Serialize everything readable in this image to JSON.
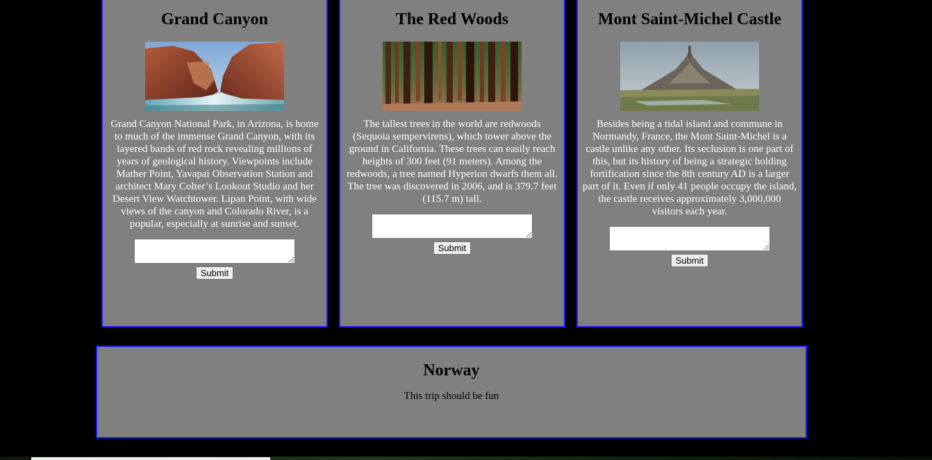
{
  "cards": [
    {
      "title": "Grand Canyon",
      "description": "Grand Canyon National Park, in Arizona, is home to much of the immense Grand Canyon, with its layered bands of red rock revealing millions of years of geological history. Viewpoints include Mather Point, Yavapai Observation Station and architect Mary Colter’s Lookout Studio and her Desert View Watchtower. Lipan Point, with wide views of the canyon and Colorado River, is a popular, especially at sunrise and sunset.",
      "input_value": "",
      "submit_label": "Submit"
    },
    {
      "title": "The Red Woods",
      "description": "The tallest trees in the world are redwoods (Sequoia sempervirens), which tower above the ground in California. These trees can easily reach heights of 300 feet (91 meters). Among the redwoods, a tree named Hyperion dwarfs them all. The tree was discovered in 2006, and is 379.7 feet (115.7 m) tall.",
      "input_value": "",
      "submit_label": "Submit"
    },
    {
      "title": "Mont Saint-Michel Castle",
      "description": "Besides being a tidal island and commune in Normandy, France, the Mont Saint-Michel is a castle unlike any other. Its seclusion is one part of this, but its history of being a strategic holding fortification since the 8th century AD is a larger part of it. Even if only 41 people occupy the island, the castle receives approximately 3,000,000 visitors each year.",
      "input_value": "",
      "submit_label": "Submit"
    }
  ],
  "panel": {
    "title": "Norway",
    "text": "This trip should be fun"
  },
  "colors": {
    "page_background": "#000000",
    "card_background": "#808080",
    "card_border": "#1a1aff",
    "card_text": "#ffffff"
  }
}
